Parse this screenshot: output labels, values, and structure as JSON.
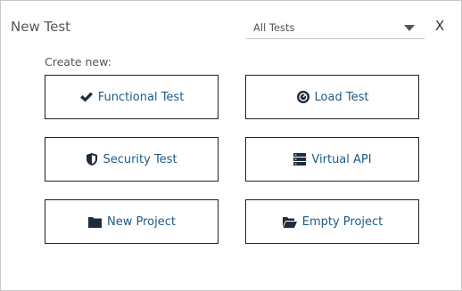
{
  "dialog": {
    "title": "New Test",
    "close_label": "X"
  },
  "filter": {
    "selected": "All Tests"
  },
  "create": {
    "label": "Create new:",
    "options": [
      {
        "label": "Functional Test",
        "icon": "checkmark-icon"
      },
      {
        "label": "Load Test",
        "icon": "gauge-icon"
      },
      {
        "label": "Security Test",
        "icon": "shield-icon"
      },
      {
        "label": "Virtual API",
        "icon": "server-icon"
      },
      {
        "label": "New Project",
        "icon": "folder-icon"
      },
      {
        "label": "Empty Project",
        "icon": "folder-open-icon"
      }
    ]
  },
  "colors": {
    "link": "#1d5a85",
    "icon": "#1f2d3a",
    "border": "#222222"
  }
}
